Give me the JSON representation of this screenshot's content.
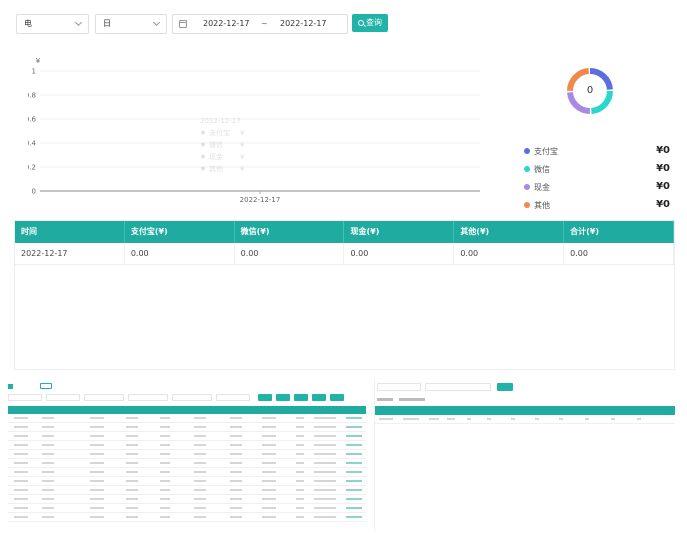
{
  "filters": {
    "type_select": "电",
    "period_select": "日",
    "date_start": "2022-12-17",
    "date_separator": "~",
    "date_end": "2022-12-17",
    "query_label": "查询"
  },
  "chart_data": [
    {
      "type": "line",
      "ylabel": "¥",
      "x": [
        "2022-12-17"
      ],
      "ylim": [
        0,
        1
      ],
      "yticks": [
        "0",
        "0.2",
        "0.4",
        "0.6",
        "0.8",
        "1"
      ],
      "series": [
        {
          "name": "支付宝",
          "values": [
            0
          ]
        },
        {
          "name": "微信",
          "values": [
            0
          ]
        },
        {
          "name": "现金",
          "values": [
            0
          ]
        },
        {
          "name": "其他",
          "values": [
            0
          ]
        }
      ],
      "tooltip": {
        "title": "2022-12-17",
        "rows": [
          {
            "name": "支付宝",
            "value": "¥"
          },
          {
            "name": "微信",
            "value": "¥"
          },
          {
            "name": "现金",
            "value": "¥"
          },
          {
            "name": "其他",
            "value": "¥"
          }
        ]
      }
    },
    {
      "type": "pie",
      "center_label": "0",
      "categories": [
        "支付宝",
        "微信",
        "现金",
        "其他"
      ],
      "values": [
        0,
        0,
        0,
        0
      ],
      "legend_values": [
        "¥0",
        "¥0",
        "¥0",
        "¥0"
      ],
      "colors": [
        "#5b6ee1",
        "#2ad6d0",
        "#a889e8",
        "#f08a4b"
      ]
    }
  ],
  "summary_table": {
    "headers": [
      "时间",
      "支付宝(¥)",
      "微信(¥)",
      "现金(¥)",
      "其他(¥)",
      "合计(¥)"
    ],
    "rows": [
      [
        "2022-12-17",
        "0.00",
        "0.00",
        "0.00",
        "0.00",
        "0.00"
      ]
    ]
  },
  "colors": {
    "accent": "#22b3a8",
    "table_header": "#1fab9f"
  }
}
